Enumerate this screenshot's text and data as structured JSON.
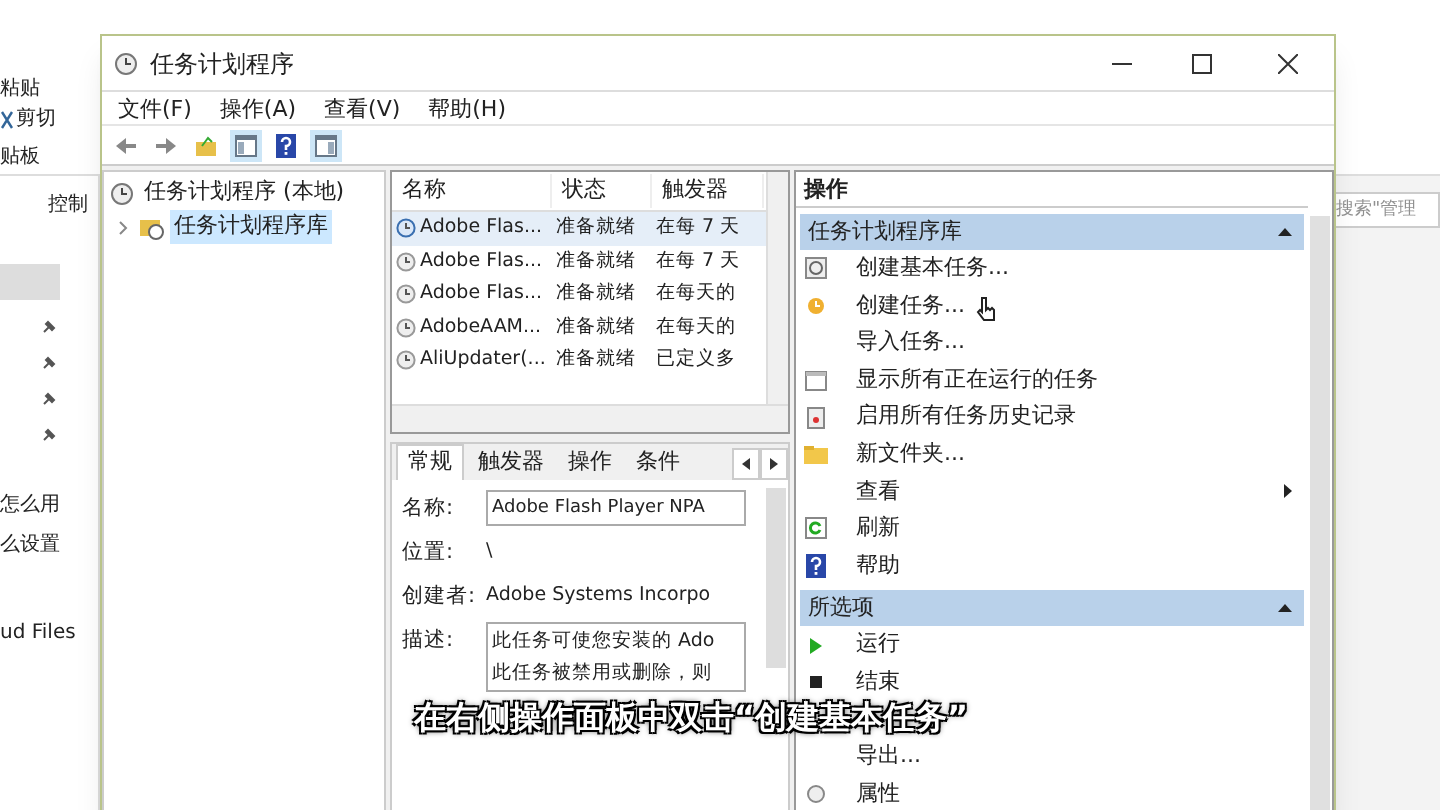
{
  "background_explorer": {
    "ribbon_labels": [
      "粘贴",
      "剪切",
      "贴板"
    ],
    "breadcrumb": "控制",
    "sidebar_items": [
      "怎么用",
      "么设置",
      "ud Files"
    ],
    "search": {
      "placeholder": "搜索\"管理"
    }
  },
  "window": {
    "title": "任务计划程序"
  },
  "menu": [
    "文件(F)",
    "操作(A)",
    "查看(V)",
    "帮助(H)"
  ],
  "tree": [
    {
      "label": "任务计划程序 (本地)",
      "selected": false,
      "children": [
        {
          "label": "任务计划程序库",
          "selected": true
        }
      ]
    }
  ],
  "task_list": {
    "columns": [
      "名称",
      "状态",
      "触发器"
    ],
    "rows": [
      {
        "cells": [
          "Adobe Flas...",
          "准备就绪",
          "在每 7 天"
        ],
        "selected": true
      },
      {
        "cells": [
          "Adobe Flas...",
          "准备就绪",
          "在每 7 天"
        ],
        "selected": false
      },
      {
        "cells": [
          "Adobe Flas...",
          "准备就绪",
          "在每天的"
        ],
        "selected": false
      },
      {
        "cells": [
          "AdobeAAM...",
          "准备就绪",
          "在每天的"
        ],
        "selected": false
      },
      {
        "cells": [
          "AliUpdater(...",
          "准备就绪",
          "已定义多"
        ],
        "selected": false
      }
    ]
  },
  "detail": {
    "tabs": [
      {
        "label": "常规",
        "selected": true
      },
      {
        "label": "触发器",
        "selected": false
      },
      {
        "label": "操作",
        "selected": false
      },
      {
        "label": "条件",
        "selected": false
      }
    ],
    "fields": [
      {
        "kind": "input",
        "label": "名称:",
        "value": "Adobe Flash Player NPA"
      },
      {
        "kind": "text",
        "label": "位置:",
        "value": "\\"
      },
      {
        "kind": "text",
        "label": "创建者:",
        "value": "Adobe Systems Incorpo"
      },
      {
        "kind": "textarea",
        "label": "描述:",
        "value": "此任务可使您安装的 Ado\n此任务被禁用或删除，则"
      }
    ]
  },
  "actions": {
    "title": "操作",
    "sections": [
      {
        "title": "任务计划程序库",
        "items": [
          {
            "label": "创建基本任务...",
            "submenu": false
          },
          {
            "label": "创建任务...",
            "submenu": false
          },
          {
            "label": "导入任务...",
            "submenu": false
          },
          {
            "label": "显示所有正在运行的任务",
            "submenu": false
          },
          {
            "label": "启用所有任务历史记录",
            "submenu": false
          },
          {
            "label": "新文件夹...",
            "submenu": false
          },
          {
            "label": "查看",
            "submenu": true
          },
          {
            "label": "刷新",
            "submenu": false
          },
          {
            "label": "帮助",
            "submenu": false
          }
        ]
      },
      {
        "title": "所选项",
        "items": [
          {
            "label": "运行",
            "submenu": false
          },
          {
            "label": "结束",
            "submenu": false
          },
          {
            "label": "导出...",
            "submenu": false
          },
          {
            "label": "属性",
            "submenu": false
          }
        ]
      }
    ]
  },
  "subtitle": "在右侧操作面板中双击“创建基本任务”"
}
